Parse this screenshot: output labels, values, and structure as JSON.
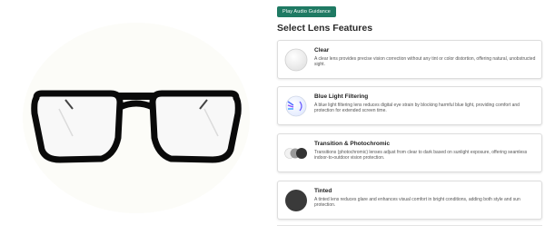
{
  "product": {
    "image_alt": "black aviator eyeglasses frame"
  },
  "audio_button": {
    "label": "Play Audio Guidance"
  },
  "section": {
    "title": "Select Lens Features"
  },
  "lens_options": [
    {
      "title": "Clear",
      "description": "A clear lens provides precise vision correction without any tint or color distortion, offering natural, unobstructed sight.",
      "icon": "clear-lens-icon"
    },
    {
      "title": "Blue Light Filtering",
      "description": "A blue light filtering lens reduces digital eye strain by blocking harmful blue light, providing comfort and protection for extended screen time.",
      "icon": "blue-light-lens-icon"
    },
    {
      "title": "Transition & Photochromic",
      "description": "Transitions (photochromic) lenses adjust from clear to dark based on sunlight exposure, offering seamless indoor-to-outdoor vision protection.",
      "icon": "photochromic-lens-icon"
    },
    {
      "title": "Tinted",
      "description": "A tinted lens reduces glare and enhances visual comfort in bright conditions, adding both style and sun protection.",
      "icon": "tinted-lens-icon"
    }
  ],
  "colors": {
    "accent": "#1f7a63",
    "frame": "#0a0a0a",
    "tint": "#3a3a3a"
  }
}
